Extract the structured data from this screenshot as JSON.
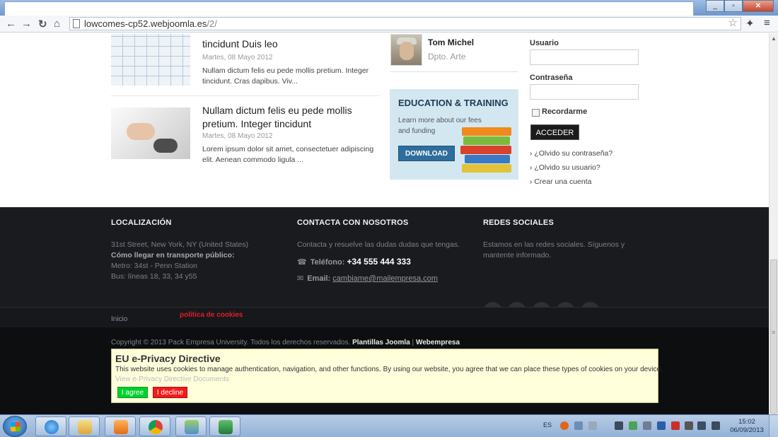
{
  "browser": {
    "url_host": "lowcomes-cp52.webjoomla.es",
    "url_path": "/2/"
  },
  "articles": [
    {
      "title": "tincidunt Duis leo",
      "date": "Martes, 08 Mayo 2012",
      "text": "Nullam dictum felis eu pede mollis pretium. Integer tincidunt. Cras dapibus. Viv..."
    },
    {
      "title": "Nullam dictum felis eu pede mollis pretium. Integer tincidunt",
      "date": "Martes, 08 Mayo 2012",
      "text": "Lorem ipsum dolor sit amet, consectetuer adipiscing elit. Aenean commodo ligula ..."
    }
  ],
  "team": {
    "name": "Tom Michel",
    "role": "Dpto. Arte"
  },
  "education": {
    "title": "EDUCATION & TRAINING",
    "subtitle": "Learn more about our fees and funding",
    "button": "DOWNLOAD"
  },
  "login": {
    "user_label": "Usuario",
    "password_label": "Contraseña",
    "remember_label": "Recordarme",
    "submit_label": "ACCEDER",
    "forgot_password": "¿Olvido su contraseña?",
    "forgot_user": "¿Olvido su usuario?",
    "create_account": "Crear una cuenta"
  },
  "footer": {
    "location": {
      "heading": "LOCALIZACIÓN",
      "address": "31st Street, New York, NY (United States)",
      "transport_heading": "Cómo llegar en transporte público:",
      "metro": "Metro: 34st - Penn Station",
      "bus": "Bus: líneas 18, 33, 34 y55"
    },
    "contact": {
      "heading": "CONTACTA CON NOSOTROS",
      "intro": "Contacta y resuelve las dudas dudas que tengas.",
      "phone_label": "Teléfono:",
      "phone": "+34 555 444 333",
      "email_label": "Email:",
      "email": "cambiame@mailempresa.com"
    },
    "social": {
      "heading": "REDES SOCIALES",
      "intro": "Estamos en las redes sociales. Síguenos y mantente informado.",
      "icons": [
        "twitter-icon",
        "facebook-icon",
        "googleplus-icon",
        "rss-icon",
        "vimeo-icon"
      ],
      "glyphs": [
        "🐦",
        "f",
        "g",
        "⌘",
        "v"
      ]
    },
    "inicio": "Inicio",
    "cookies": "política de cookies",
    "copyright": "Copyright © 2013 Pack Empresa University. Todos los derechos reservados.",
    "link1": "Plantillas Joomla",
    "separator": "|",
    "link2": "Webempresa"
  },
  "privacy": {
    "title": "EU e-Privacy Directive",
    "text": "This website uses cookies to manage authentication, navigation, and other functions. By using our website, you agree that we can place these types of cookies on your device.",
    "link": "View e-Privacy Directive Documents",
    "agree": "I agree",
    "decline": "I decline"
  },
  "taskbar": {
    "lang": "ES",
    "time": "15:02",
    "date": "06/09/2013"
  },
  "colors": {
    "footer_bg": "#191b1f",
    "accent_blue": "#2e6d9c",
    "cookie_red": "#e02020",
    "agree_green": "#00d12c",
    "decline_red": "#f21b1b"
  }
}
